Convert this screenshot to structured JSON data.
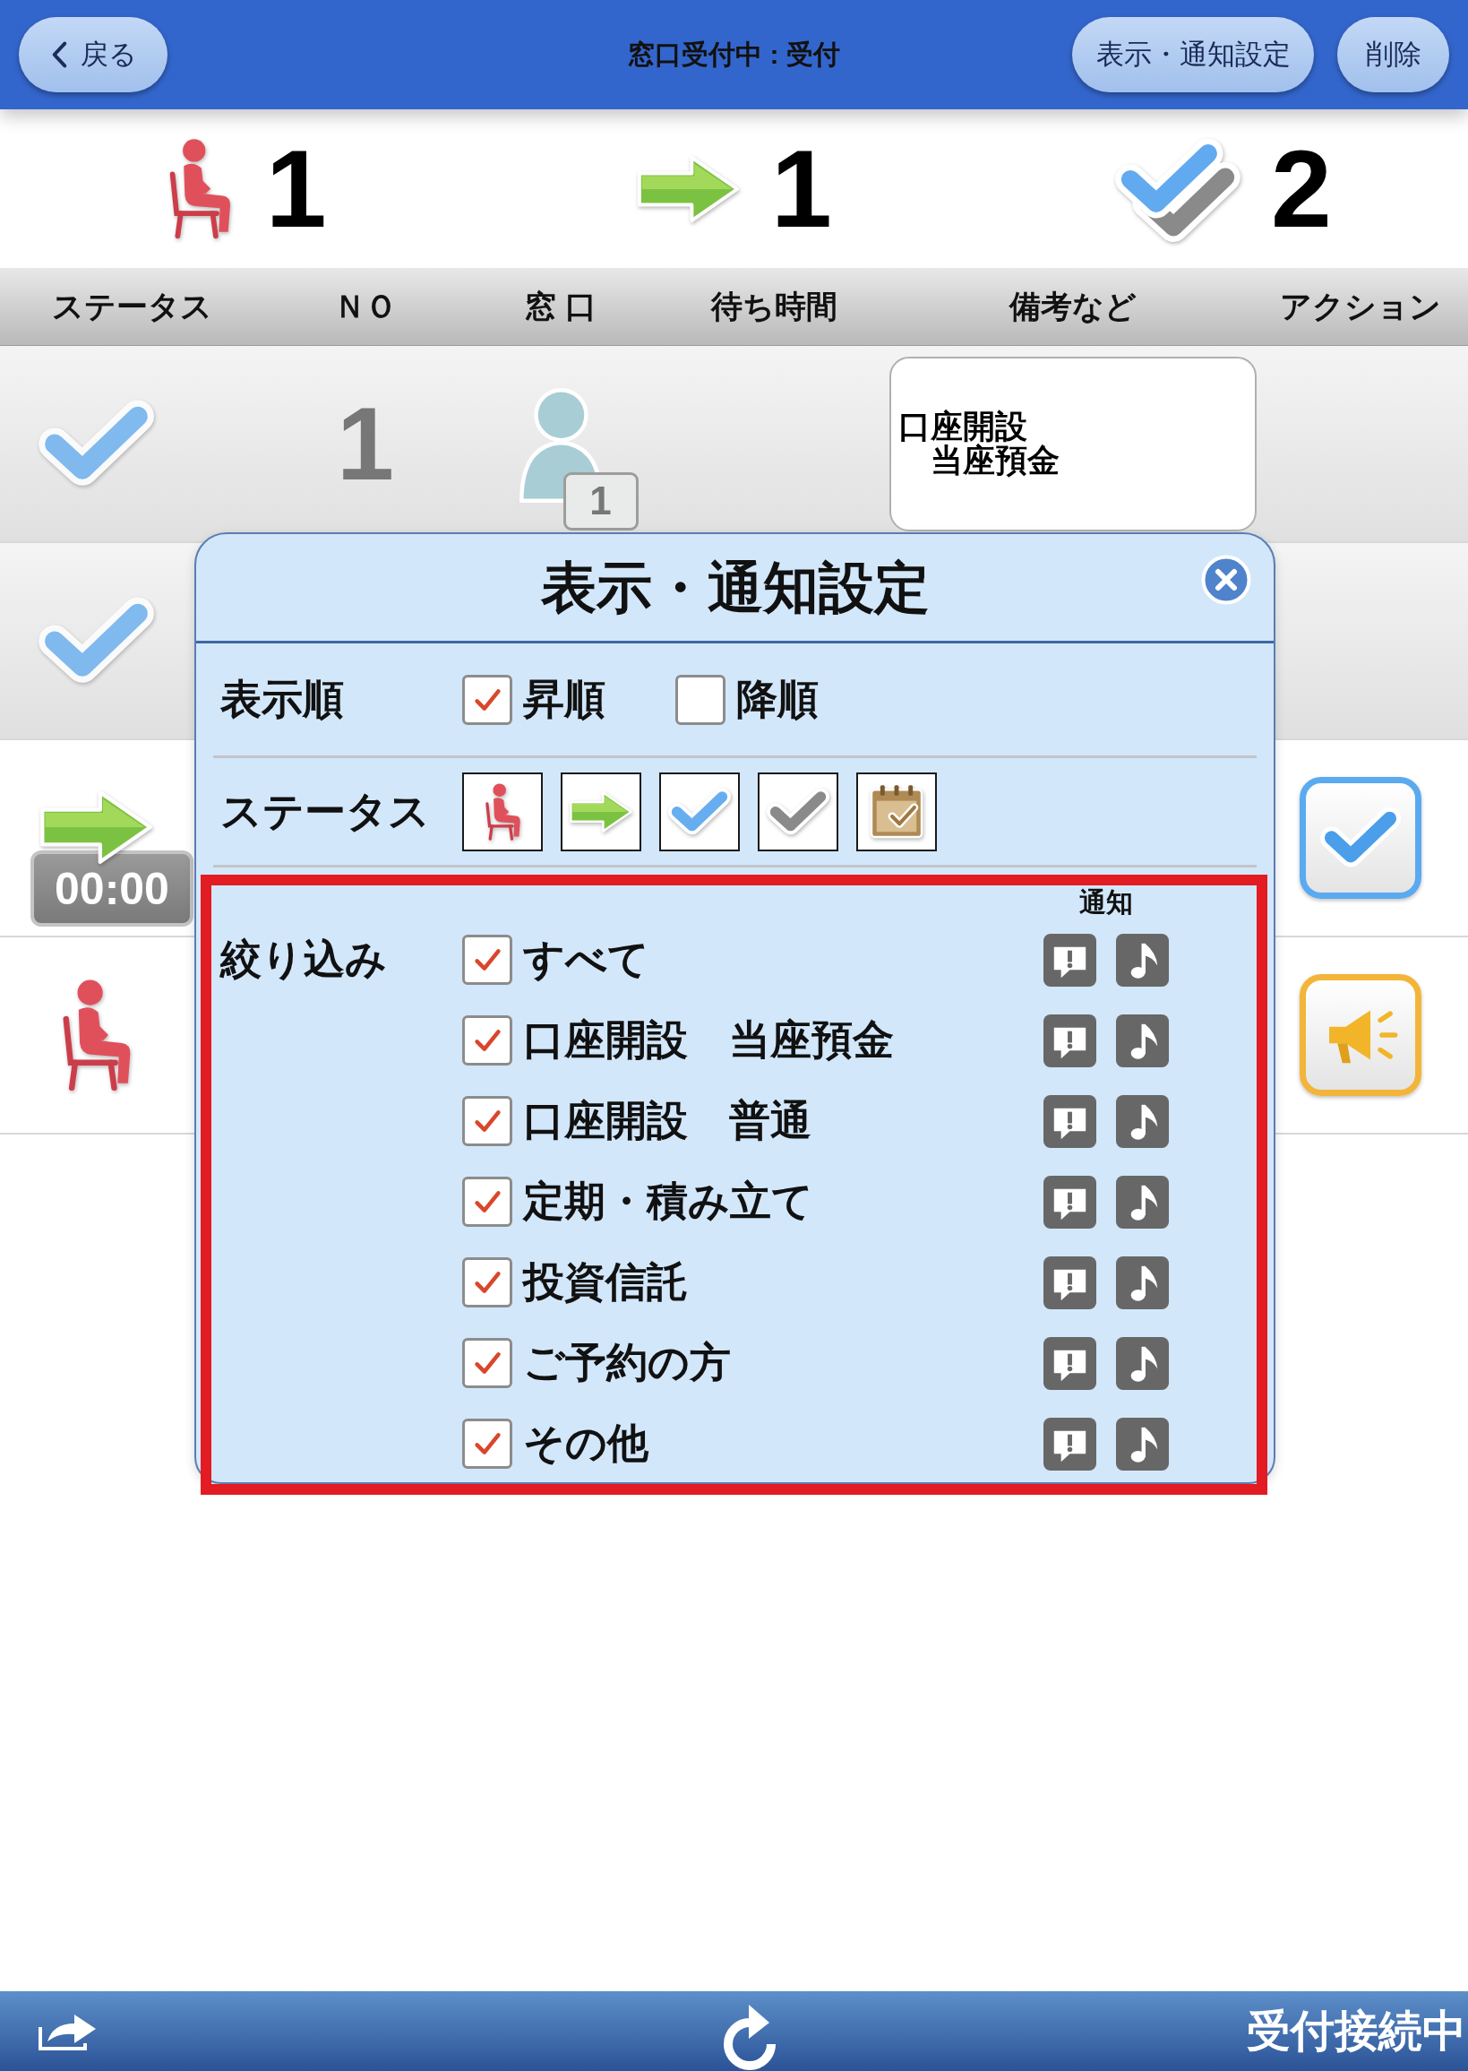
{
  "header": {
    "back": "戻る",
    "title": "窓口受付中 : 受付",
    "buttons": [
      {
        "kind": "settings",
        "label": "表示・通知設定"
      },
      {
        "kind": "delete",
        "label": "削除"
      }
    ]
  },
  "counters": [
    {
      "kind": "waiting",
      "count": "1"
    },
    {
      "kind": "called",
      "count": "1"
    },
    {
      "kind": "finished",
      "count": "2"
    }
  ],
  "table": {
    "columns": [
      "ステータス",
      "ＮＯ",
      "窓 口",
      "待ち時間",
      "備考など",
      "アクション"
    ],
    "rows": [
      {
        "status": {
          "kind": "done"
        },
        "number": "1",
        "window": {
          "badge": "1"
        },
        "remark": [
          "口座開設",
          "当座預金"
        ]
      },
      {
        "status": {
          "kind": "done"
        }
      },
      {
        "status": {
          "kind": "called"
        },
        "timer": "00:00",
        "action": {
          "kind": "complete"
        }
      },
      {
        "status": {
          "kind": "waiting"
        },
        "action": {
          "kind": "call"
        }
      }
    ]
  },
  "settings_dialog": {
    "title": "表示・通知設定",
    "sort": {
      "label": "表示順",
      "options": [
        {
          "label": "昇順",
          "checked": true
        },
        {
          "label": "降順",
          "checked": false
        }
      ]
    },
    "status_filter": {
      "label": "ステータス",
      "items": [
        {
          "kind": "waiting"
        },
        {
          "kind": "called"
        },
        {
          "kind": "done"
        },
        {
          "kind": "cancelled"
        },
        {
          "kind": "reserved"
        }
      ]
    },
    "filter": {
      "label": "絞り込み",
      "notify_header": "通知",
      "items": [
        {
          "label": "すべて",
          "checked": true
        },
        {
          "label": "口座開設　当座預金",
          "checked": true
        },
        {
          "label": "口座開設　普通",
          "checked": true
        },
        {
          "label": "定期・積み立て",
          "checked": true
        },
        {
          "label": "投資信託",
          "checked": true
        },
        {
          "label": "ご予約の方",
          "checked": true
        },
        {
          "label": "その他",
          "checked": true
        }
      ]
    }
  },
  "bottom_bar": {
    "status": "受付接続中"
  }
}
